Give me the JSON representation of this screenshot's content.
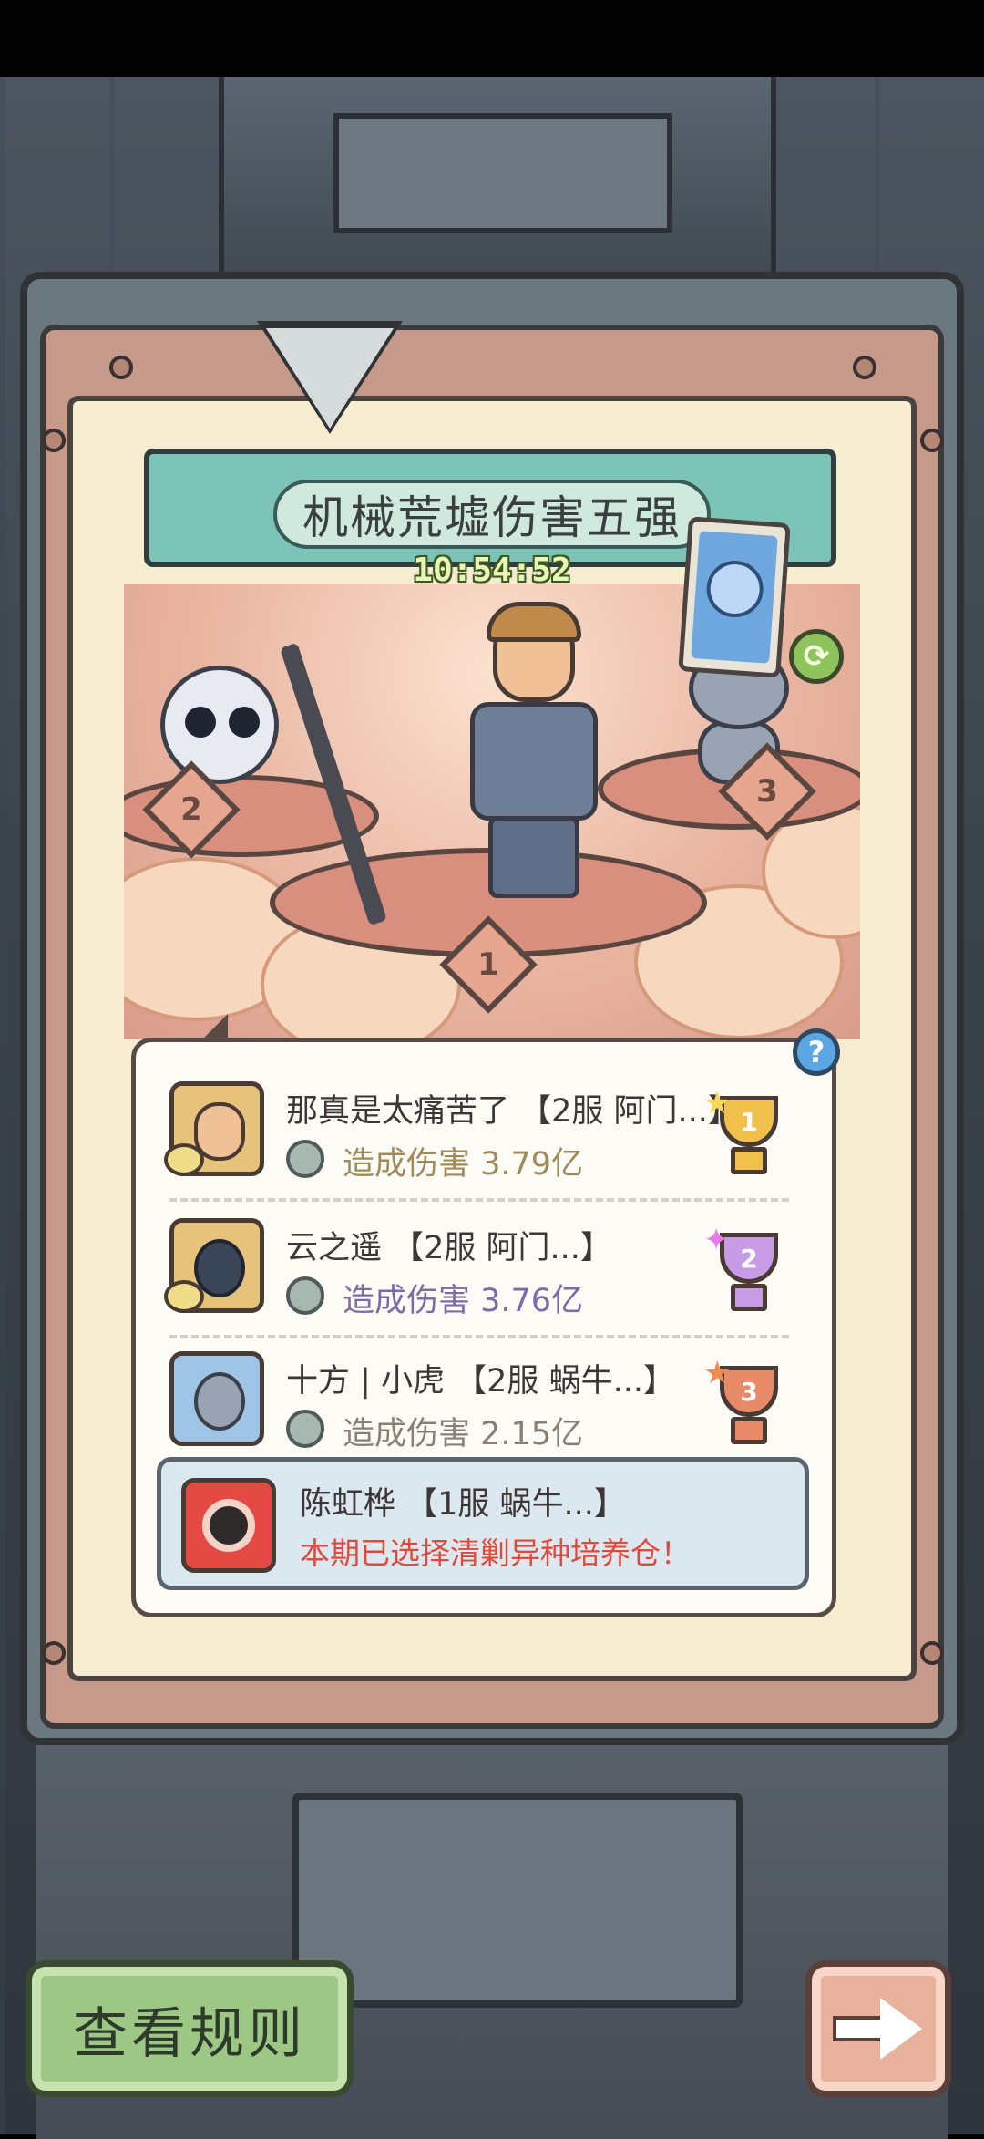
{
  "header": {
    "title": "机械荒墟伤害五强",
    "timer": "10:54:52"
  },
  "podium": {
    "ranks": [
      "1",
      "2",
      "3"
    ]
  },
  "help": {
    "label": "?"
  },
  "leaderboard": {
    "entries": [
      {
        "rank": "1",
        "name": "那真是太痛苦了 【2服  阿门...】",
        "damage": "造成伤害  3.79亿",
        "color": "#a08a5a"
      },
      {
        "rank": "2",
        "name": "云之遥 【2服  阿门...】",
        "damage": "造成伤害  3.76亿",
        "color": "#7d6aa8"
      },
      {
        "rank": "3",
        "name": "十方 | 小虎  【2服  蜗牛...】",
        "damage": "造成伤害  2.15亿",
        "color": "#8a7f74"
      }
    ],
    "self": {
      "name": "陈虹桦 【1服  蜗牛...】",
      "message": "本期已选择清剿异种培养仓！"
    }
  },
  "buttons": {
    "rules_label": "查看规则"
  },
  "colors": {
    "title_bar": "#7cc3b8",
    "self_message": "#e04a3c",
    "gold": "#f0c04a",
    "silver": "#c79be6",
    "bronze": "#e88a68"
  },
  "icons": {
    "refresh": "refresh-icon",
    "next": "arrow-right-icon",
    "help": "question-icon"
  }
}
